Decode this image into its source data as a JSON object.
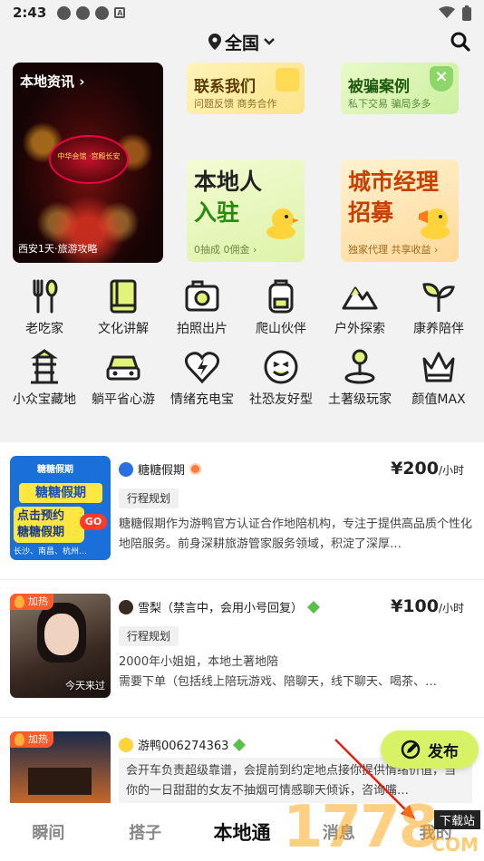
{
  "status": {
    "time": "2:43"
  },
  "header": {
    "location": "全国"
  },
  "news_card": {
    "title": "本地资讯",
    "caption": "西安1天·旅游攻略",
    "image_text": "中华会馆 ·宫殿长安"
  },
  "promos": {
    "contact": {
      "title": "联系我们",
      "subtitle": "问题反馈 商务合作"
    },
    "fraud": {
      "title": "被骗案例",
      "subtitle": "私下交易 骗局多多"
    },
    "local": {
      "title_line1": "本地人",
      "title_line2": "入驻",
      "subtitle": "0抽成 0佣金 ›"
    },
    "city": {
      "title_line1": "城市经理",
      "title_line2": "招募",
      "subtitle": "独家代理 共享收益 ›"
    }
  },
  "categories": [
    {
      "label": "老吃家",
      "icon": "fork-spoon-icon"
    },
    {
      "label": "文化讲解",
      "icon": "book-icon"
    },
    {
      "label": "拍照出片",
      "icon": "camera-icon"
    },
    {
      "label": "爬山伙伴",
      "icon": "backpack-icon"
    },
    {
      "label": "户外探索",
      "icon": "mountain-icon"
    },
    {
      "label": "康养陪伴",
      "icon": "sprout-icon"
    },
    {
      "label": "小众宝藏地",
      "icon": "pagoda-icon"
    },
    {
      "label": "躺平省心游",
      "icon": "car-icon"
    },
    {
      "label": "情绪充电宝",
      "icon": "heart-bolt-icon"
    },
    {
      "label": "社恐友好型",
      "icon": "smile-icon"
    },
    {
      "label": "土著级玩家",
      "icon": "map-pin-icon"
    },
    {
      "label": "颜值MAX",
      "icon": "crown-icon"
    }
  ],
  "listings": [
    {
      "name": "糖糖假期",
      "price": "¥200",
      "unit": "/小时",
      "tag": "行程规划",
      "desc": "糖糖假期作为游鸭官方认证合作地陪机构，专注于提供高品质个性化地陪服务。前身深耕旅游管家服务领域，积淀了深厚…",
      "thumb_lines": [
        "糖糖假期",
        "糖糖假期",
        "点击预约",
        "糖糖假期",
        "GO",
        "长沙、南昌、杭州…"
      ]
    },
    {
      "name": "雪梨（禁言中，会用小号回复）",
      "price": "¥100",
      "unit": "/小时",
      "tag": "行程规划",
      "badge": "加热",
      "desc_line1": "2000年小姐姐，本地土著地陪",
      "desc_line2": "需要下单（包括线上陪玩游戏、陪聊天，线下聊天、喝茶、…",
      "thumb_caption": "今天来过"
    },
    {
      "name": "游鸭006274363",
      "badge": "加热",
      "desc": "会开车负责超级靠谱，会提前到约定地点接你提供情绪价值，当你的一日甜甜的女友不抽烟可情感聊天倾诉，咨询嘴…"
    }
  ],
  "fab": {
    "label": "发布"
  },
  "tabs": [
    "瞬间",
    "搭子",
    "本地通",
    "消息",
    "我的"
  ],
  "watermark": {
    "text": "1778",
    "sub": "下载站",
    "site": "COM"
  }
}
